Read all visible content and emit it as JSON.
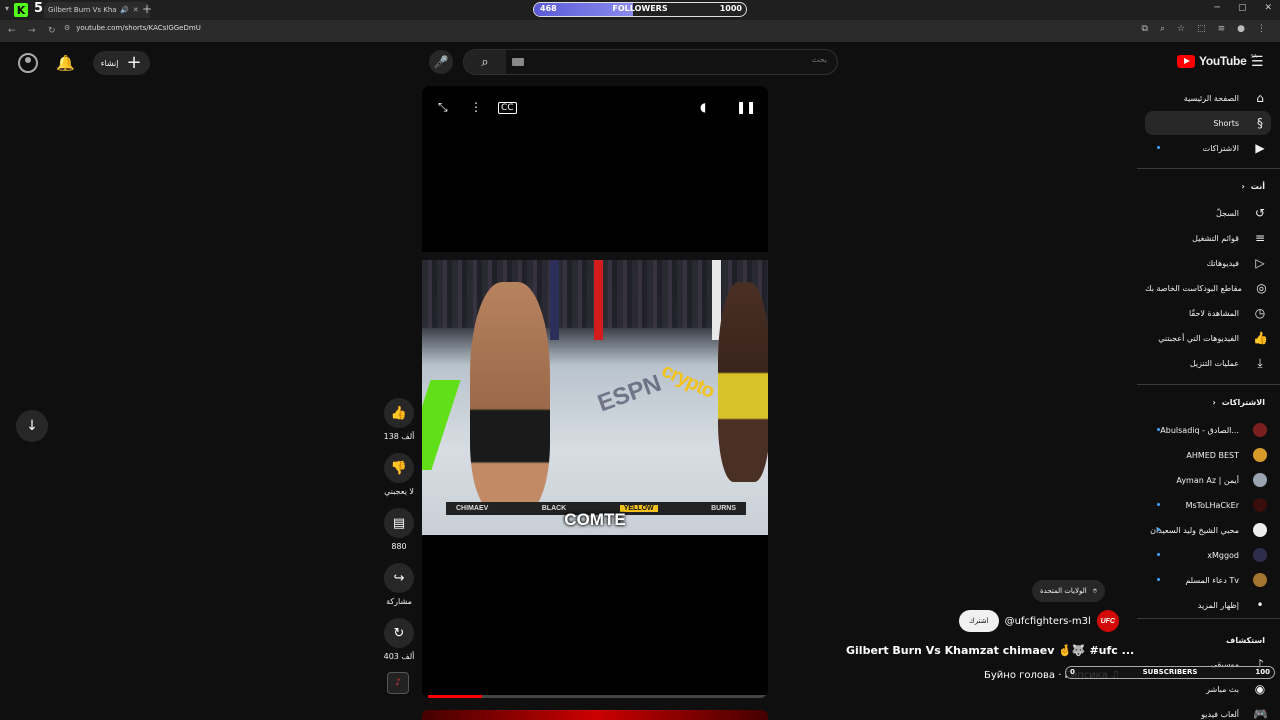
{
  "browser": {
    "tab_title": "Gilbert Burn Vs Khamzat chi...",
    "kick_count": "5",
    "url": "youtube.com/shorts/KACsIGGeDmU"
  },
  "followers_goal": {
    "label": "FOLLOWERS",
    "current": "468",
    "goal": "1000",
    "progress": 0.468
  },
  "header": {
    "create_label": "إنشاء",
    "search_placeholder": "بحث",
    "logo_text": "YouTube",
    "logo_country": "SA"
  },
  "sidebar": {
    "main": [
      {
        "label": "الصفحة الرئيسية",
        "icon": "home-icon"
      },
      {
        "label": "Shorts",
        "icon": "shorts-icon",
        "active": true
      },
      {
        "label": "الاشتراكات",
        "icon": "subscriptions-icon",
        "dot": true
      }
    ],
    "you_section": "أنت",
    "you": [
      {
        "label": "السجلّ",
        "icon": "history-icon"
      },
      {
        "label": "قوائم التشغيل",
        "icon": "playlists-icon"
      },
      {
        "label": "فيديوهاتك",
        "icon": "your-videos-icon"
      },
      {
        "label": "مقاطع البودكاست الخاصة بك",
        "icon": "podcast-icon"
      },
      {
        "label": "المشاهدة لاحقًا",
        "icon": "watch-later-icon"
      },
      {
        "label": "الفيديوهات التي أعجبتني",
        "icon": "liked-icon"
      },
      {
        "label": "عمليات التنزيل",
        "icon": "download-icon"
      }
    ],
    "subs_section": "الاشتراكات",
    "subscriptions": [
      {
        "label": "Abulsadiq - الصادق...",
        "color": "#7a1f1f",
        "dot": true
      },
      {
        "label": "AHMED BEST",
        "color": "#d79a2b",
        "dot": false
      },
      {
        "label": "Ayman Az | أيمن",
        "color": "#9aa4b0",
        "dot": false
      },
      {
        "label": "MsToLHaCkEr",
        "color": "#3a0d0d",
        "dot": true
      },
      {
        "label": "محبي الشيخ وليد السعيدان",
        "color": "#eeeeee",
        "dot": true
      },
      {
        "label": "xMggod",
        "color": "#2d2d4a",
        "dot": true
      },
      {
        "label": "دعاء المسلم Tv",
        "color": "#a4752f",
        "dot": true
      }
    ],
    "show_more": "إظهار المزيد",
    "explore_section": "استكشاف",
    "explore": [
      {
        "label": "موسيقى",
        "icon": "music-icon"
      },
      {
        "label": "بث مباشر",
        "icon": "live-icon"
      },
      {
        "label": "ألعاب فيديو",
        "icon": "gaming-icon"
      }
    ]
  },
  "player": {
    "caption": "COMTE",
    "scorebar_left": "CHIMAEV",
    "scorebar_mid": "BLACK",
    "scorebar_yellow": "YELLOW",
    "scorebar_right": "BURNS",
    "progress": 0.16
  },
  "actions": {
    "like_count": "138 ألف",
    "dislike_label": "لا يعجبني",
    "comments_count": "880",
    "share_label": "مشاركة",
    "remix_count": "403 ألف"
  },
  "meta": {
    "location": "الولايات المتحدة",
    "channel_handle": "@ufcfighters-m3l",
    "subscribe_label": "اشترك",
    "channel_avatar_text": "UFC",
    "title": "Gilbert Burn Vs Khamzat chimaev 🤞🐺 #ufc ...",
    "music": "Буйно голова · Гипсика ♫"
  },
  "subscribers_goal": {
    "label": "SUBSCRIBERS",
    "current": "0",
    "goal": "100",
    "progress": 0.0
  }
}
